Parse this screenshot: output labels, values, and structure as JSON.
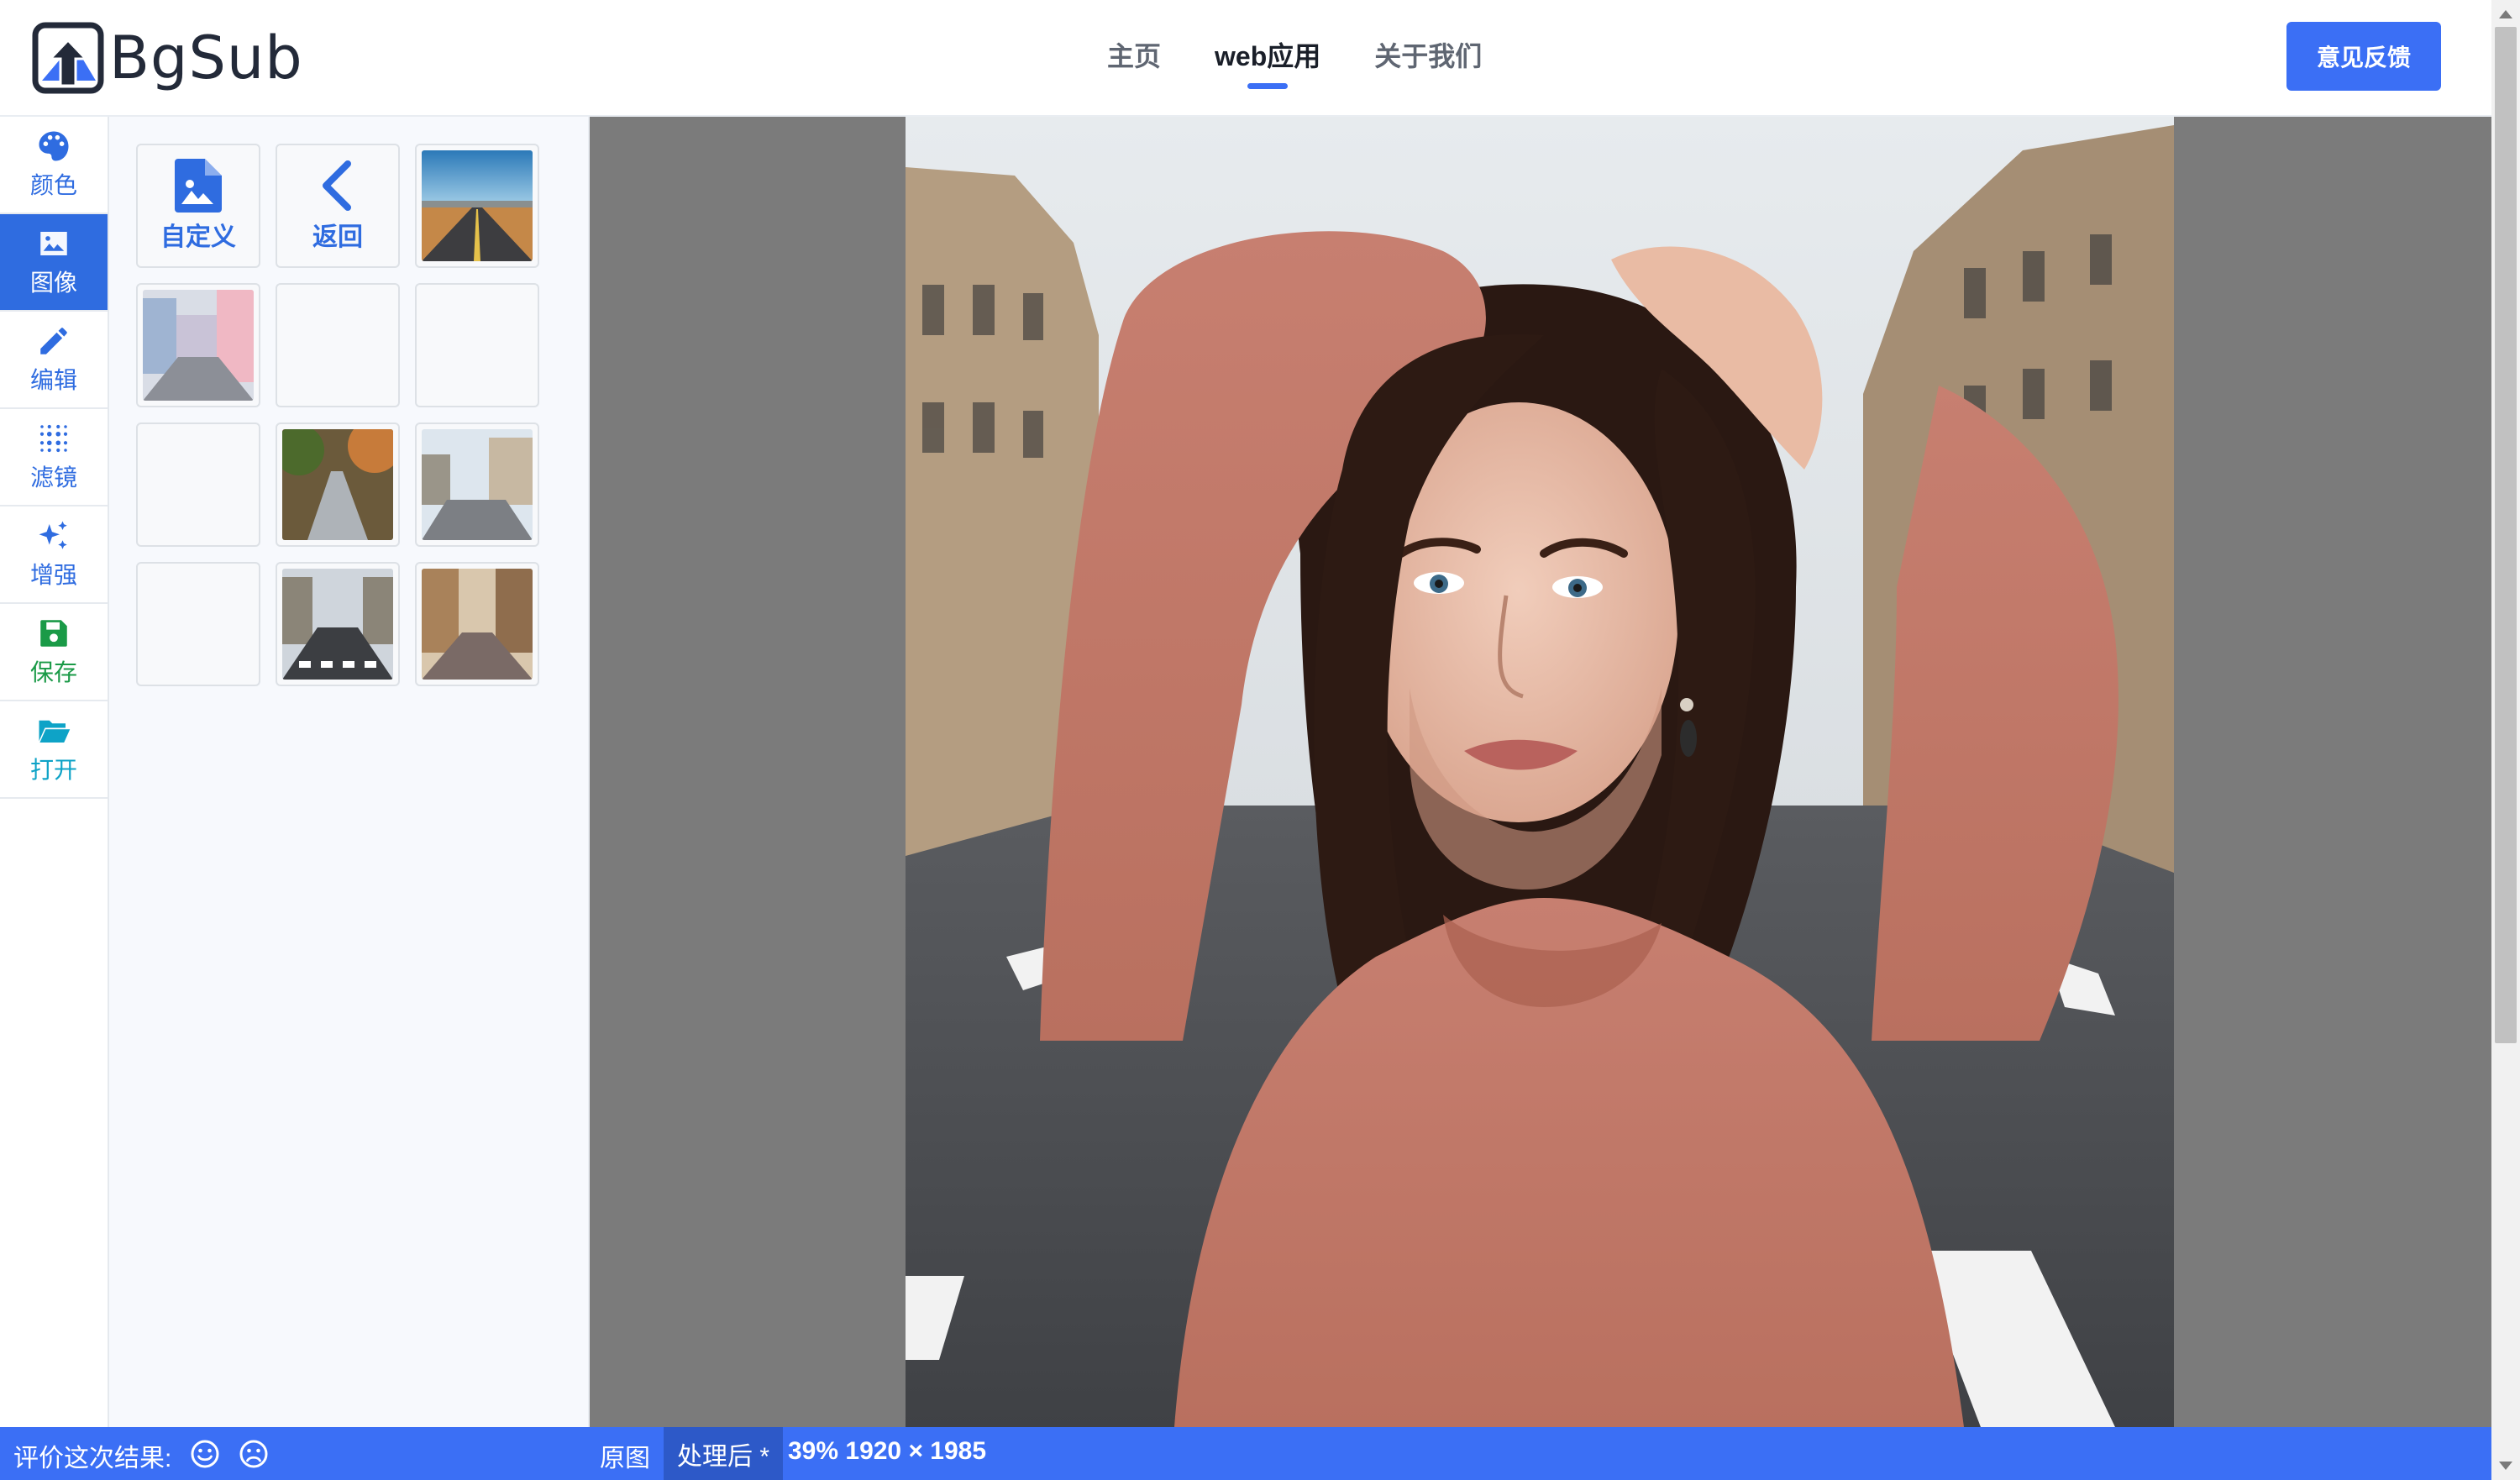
{
  "brand": {
    "name": "BgSub"
  },
  "nav": {
    "items": [
      "主页",
      "web应用",
      "关于我们"
    ],
    "active": "web应用"
  },
  "header": {
    "feedback_label": "意见反馈"
  },
  "tools": [
    {
      "label": "颜色",
      "icon": "palette-icon"
    },
    {
      "label": "图像",
      "icon": "image-icon",
      "active": true
    },
    {
      "label": "编辑",
      "icon": "pencil-icon"
    },
    {
      "label": "滤镜",
      "icon": "filter-dots-icon"
    },
    {
      "label": "增强",
      "icon": "sparkles-icon"
    },
    {
      "label": "保存",
      "icon": "floppy-icon"
    },
    {
      "label": "打开",
      "icon": "folder-open-icon"
    }
  ],
  "panel": {
    "custom_label": "自定义",
    "back_label": "返回"
  },
  "bottom": {
    "rate_label": "评价这次结果:",
    "original_label": "原图",
    "processed_label": "处理后 *",
    "info": "39% 1920 × 1985"
  },
  "colors": {
    "accent": "#3b6ff5",
    "rail_active": "#2f6ce0",
    "save_green": "#1a9a47",
    "open_teal": "#0ea3c7",
    "canvas_bg": "#7b7b7b"
  }
}
